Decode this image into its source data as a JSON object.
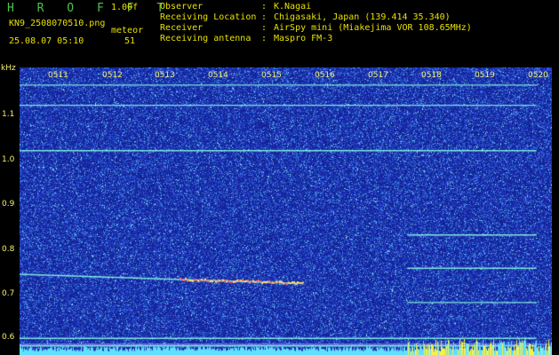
{
  "header": {
    "brand": "H R O F F T",
    "version": "1.00f",
    "filename": "KN9_2508070510.png",
    "meteor_label": "meteor",
    "timestamp": "25.08.07 05:10",
    "meteor_count": "51",
    "info": [
      {
        "key": "Observer",
        "value": "K.Nagai"
      },
      {
        "key": "Receiving Location",
        "value": "Chigasaki, Japan (139.414 35.340)"
      },
      {
        "key": "Receiver",
        "value": "AirSpy mini (Miakejima VOR 108.65MHz)"
      },
      {
        "key": "Receiving antenna",
        "value": "Maspro FM-3"
      }
    ]
  },
  "colors": {
    "background": "#000000",
    "label": "#e8e000",
    "brand": "#4fc24f",
    "plot_bg": "#1d2fa8",
    "trace": "#7fe8e0"
  },
  "plot": {
    "unit": "kHz",
    "y_labels": [
      "1.1",
      "1.0",
      "0.9",
      "0.8",
      "0.7",
      "0.6"
    ],
    "x_labels": [
      "0511",
      "0512",
      "0513",
      "0514",
      "0515",
      "0516",
      "0517",
      "0518",
      "0519",
      "0520"
    ]
  },
  "chart_data": {
    "type": "heatmap",
    "x": [
      "0511",
      "0512",
      "0513",
      "0514",
      "0515",
      "0516",
      "0517",
      "0518",
      "0519",
      "0520"
    ],
    "ylabel": "kHz",
    "ylim": [
      0.58,
      1.15
    ],
    "series": [
      {
        "x": [
          "0510",
          "0520"
        ],
        "y": [
          1.115,
          1.115
        ]
      },
      {
        "x": [
          "0510",
          "0520"
        ],
        "y": [
          1.075,
          1.075
        ]
      },
      {
        "x": [
          "0510",
          "0520"
        ],
        "y": [
          0.985,
          0.985
        ]
      },
      {
        "x": [
          "0517.5",
          "0520"
        ],
        "y": [
          0.818,
          0.818
        ]
      },
      {
        "x": [
          "0517.5",
          "0520"
        ],
        "y": [
          0.752,
          0.752
        ]
      },
      {
        "x": [
          "0510",
          "0515.4"
        ],
        "y": [
          0.74,
          0.722
        ]
      },
      {
        "x": [
          "0517.5",
          "0520"
        ],
        "y": [
          0.684,
          0.684
        ]
      },
      {
        "x": [
          "0510",
          "0520"
        ],
        "y": [
          0.613,
          0.613
        ]
      },
      {
        "x": [
          "0510",
          "0520"
        ],
        "y": [
          0.598,
          0.598
        ]
      }
    ]
  }
}
